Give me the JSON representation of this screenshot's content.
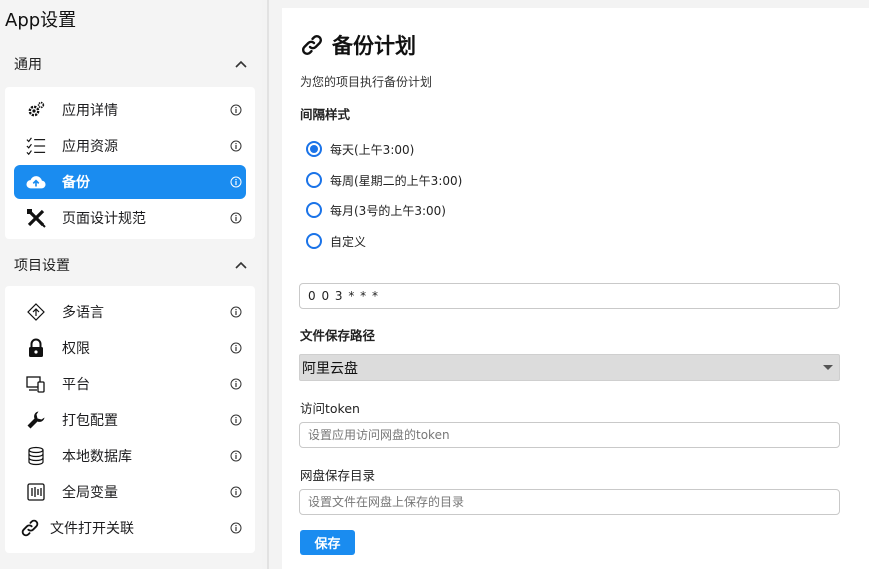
{
  "app": {
    "title": "App设置"
  },
  "sidebar": {
    "sections": [
      {
        "label": "通用",
        "items": [
          {
            "label": "应用详情",
            "icon": "gear-cog-icon"
          },
          {
            "label": "应用资源",
            "icon": "checklist-icon"
          },
          {
            "label": "备份",
            "icon": "cloud-upload-icon",
            "active": true
          },
          {
            "label": "页面设计规范",
            "icon": "design-tools-icon"
          }
        ]
      },
      {
        "label": "项目设置",
        "items": [
          {
            "label": "多语言",
            "icon": "translate-icon"
          },
          {
            "label": "权限",
            "icon": "lock-icon"
          },
          {
            "label": "平台",
            "icon": "devices-icon"
          },
          {
            "label": "打包配置",
            "icon": "wrench-icon"
          },
          {
            "label": "本地数据库",
            "icon": "database-icon"
          },
          {
            "label": "全局变量",
            "icon": "variable-icon"
          },
          {
            "label": "文件打开关联",
            "icon": "link-icon"
          }
        ]
      }
    ]
  },
  "panel": {
    "title": "备份计划",
    "subtitle": "为您的项目执行备份计划",
    "interval_label": "间隔样式",
    "options": [
      {
        "label": "每天(上午3:00)",
        "selected": true
      },
      {
        "label": "每周(星期二的上午3:00)",
        "selected": false
      },
      {
        "label": "每月(3号的上午3:00)",
        "selected": false
      },
      {
        "label": "自定义",
        "selected": false
      }
    ],
    "cron_value": "0 0 3 * * *",
    "path_label": "文件保存路径",
    "path_value": "阿里云盘",
    "token_label": "访问token",
    "token_placeholder": "设置应用访问网盘的token",
    "dir_label": "网盘保存目录",
    "dir_placeholder": "设置文件在网盘上保存的目录",
    "save_label": "保存"
  },
  "colors": {
    "accent": "#1a8cf0",
    "radio": "#1a73e8"
  }
}
